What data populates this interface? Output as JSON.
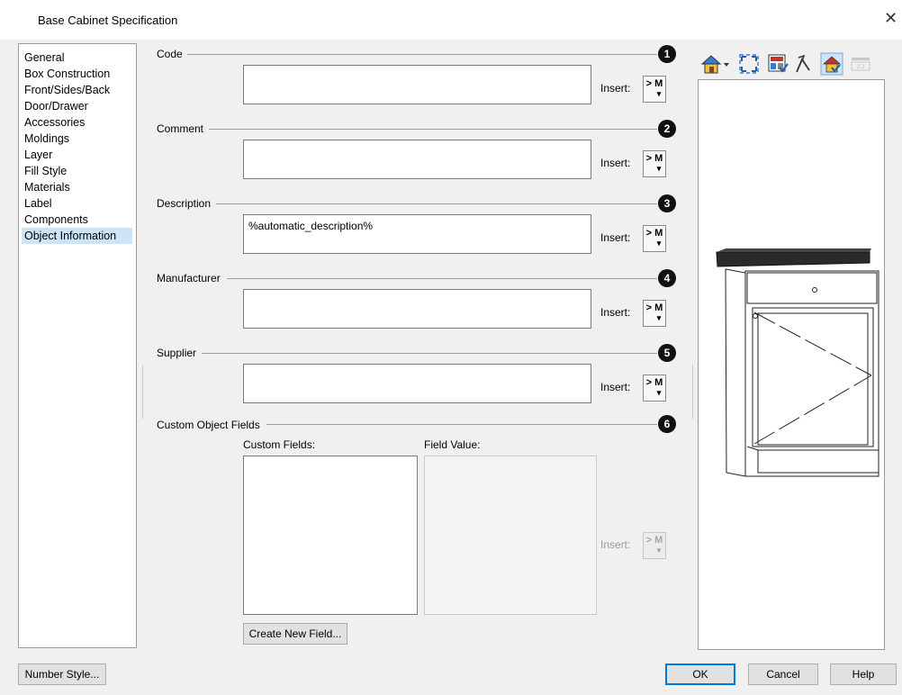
{
  "window": {
    "title": "Base Cabinet Specification",
    "close_glyph": "✕"
  },
  "nav": {
    "items": [
      {
        "label": "General",
        "selected": false
      },
      {
        "label": "Box Construction",
        "selected": false
      },
      {
        "label": "Front/Sides/Back",
        "selected": false
      },
      {
        "label": "Door/Drawer",
        "selected": false
      },
      {
        "label": "Accessories",
        "selected": false
      },
      {
        "label": "Moldings",
        "selected": false
      },
      {
        "label": "Layer",
        "selected": false
      },
      {
        "label": "Fill Style",
        "selected": false
      },
      {
        "label": "Materials",
        "selected": false
      },
      {
        "label": "Label",
        "selected": false
      },
      {
        "label": "Components",
        "selected": false
      },
      {
        "label": "Object Information",
        "selected": true
      }
    ]
  },
  "sections": {
    "code": {
      "label": "Code",
      "badge": "1",
      "value": "",
      "insert_label": "Insert:",
      "macro_label": "> M"
    },
    "comment": {
      "label": "Comment",
      "badge": "2",
      "value": "",
      "insert_label": "Insert:",
      "macro_label": "> M"
    },
    "description": {
      "label": "Description",
      "badge": "3",
      "value": "%automatic_description%",
      "insert_label": "Insert:",
      "macro_label": "> M"
    },
    "manufacturer": {
      "label": "Manufacturer",
      "badge": "4",
      "value": "",
      "insert_label": "Insert:",
      "macro_label": "> M"
    },
    "supplier": {
      "label": "Supplier",
      "badge": "5",
      "value": "",
      "insert_label": "Insert:",
      "macro_label": "> M"
    },
    "custom": {
      "label": "Custom Object Fields",
      "badge": "6",
      "custom_fields_label": "Custom Fields:",
      "field_value_label": "Field Value:",
      "insert_label": "Insert:",
      "macro_label": "> M",
      "create_button": "Create New Field..."
    }
  },
  "preview_toolbar": {
    "icons": [
      "camera-view-icon",
      "fill-window-icon",
      "render-mode-icon",
      "orbit-icon",
      "show-materials-icon",
      "show-layers-icon"
    ]
  },
  "footer": {
    "number_style": "Number Style...",
    "ok": "OK",
    "cancel": "Cancel",
    "help": "Help"
  },
  "colors": {
    "selection": "#cce4f7",
    "accent": "#0078d7",
    "badge": "#111111",
    "countertop": "#2b2b2b"
  }
}
